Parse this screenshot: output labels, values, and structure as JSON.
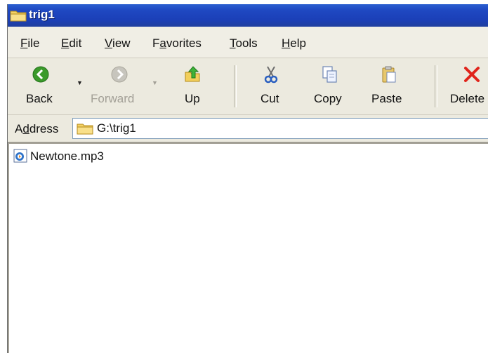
{
  "window": {
    "title": "trig1"
  },
  "menu": [
    {
      "label": "File",
      "accel": "F"
    },
    {
      "label": "Edit",
      "accel": "E"
    },
    {
      "label": "View",
      "accel": "V"
    },
    {
      "label": "Favorites",
      "accel": "a"
    },
    {
      "label": "Tools",
      "accel": "T"
    },
    {
      "label": "Help",
      "accel": "H"
    }
  ],
  "toolbar": {
    "back": {
      "label": "Back",
      "icon": "back-arrow-icon",
      "enabled": true
    },
    "forward": {
      "label": "Forward",
      "icon": "forward-arrow-icon",
      "enabled": false
    },
    "up": {
      "label": "Up",
      "icon": "folder-up-icon"
    },
    "cut": {
      "label": "Cut",
      "icon": "scissors-icon"
    },
    "copy": {
      "label": "Copy",
      "icon": "copy-icon"
    },
    "paste": {
      "label": "Paste",
      "icon": "paste-icon"
    },
    "delete": {
      "label": "Delete",
      "icon": "delete-x-icon"
    }
  },
  "address": {
    "label": "Address",
    "value": "G:\\trig1",
    "icon": "folder-icon"
  },
  "files": [
    {
      "name": "Newtone.mp3",
      "icon": "media-file-icon"
    }
  ],
  "colors": {
    "titlebar": "#1b3fb7",
    "back_green": "#3a9a2a",
    "delete_red": "#e0241b",
    "folder_yellow": "#f2cf5b"
  }
}
